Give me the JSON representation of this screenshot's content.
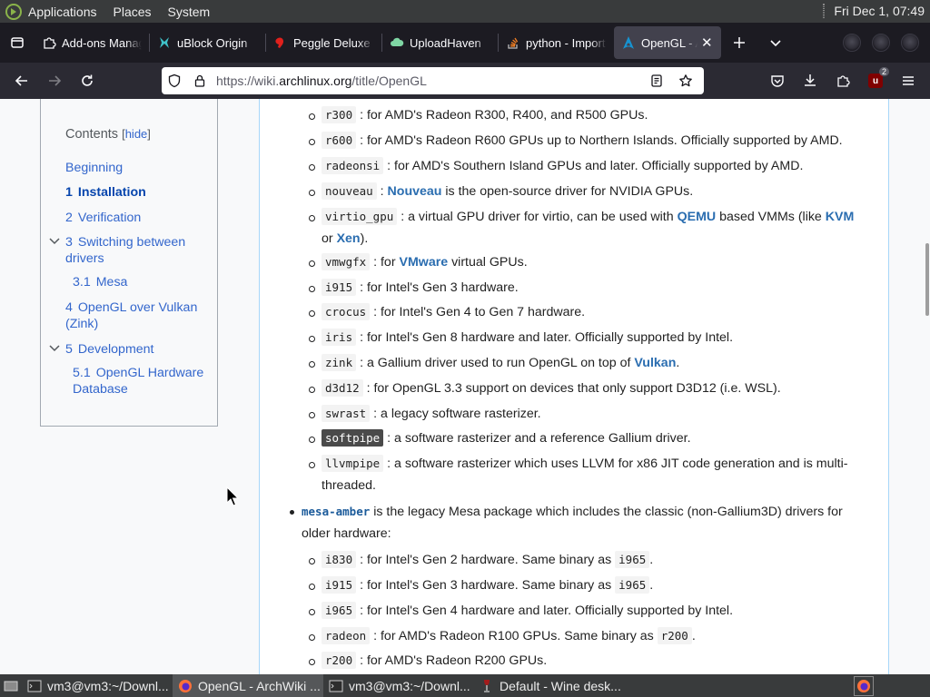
{
  "top_panel": {
    "menus": [
      "Applications",
      "Places",
      "System"
    ],
    "clock": "Fri Dec 1, 07:49"
  },
  "tabs": [
    {
      "title": "Add-ons Manager",
      "icon": "puzzle-icon"
    },
    {
      "title": "uBlock Origin",
      "icon": "ublock-icon"
    },
    {
      "title": "Peggle Deluxe",
      "icon": "peggle-icon"
    },
    {
      "title": "UploadHaven",
      "icon": "cloud-icon"
    },
    {
      "title": "python - Import",
      "icon": "stackoverflow-icon"
    },
    {
      "title": "OpenGL - ArchWiki",
      "icon": "arch-icon",
      "active": true
    }
  ],
  "urlbar": {
    "prefix": "https://wiki.",
    "domain": "archlinux.org",
    "path": "/title/OpenGL"
  },
  "ublock_count": "2",
  "toc": {
    "title": "Contents",
    "hide_label": "hide",
    "items": [
      {
        "num": "",
        "label": "Beginning"
      },
      {
        "num": "1",
        "label": "Installation"
      },
      {
        "num": "2",
        "label": "Verification"
      },
      {
        "num": "3",
        "label": "Switching between drivers"
      },
      {
        "num": "3.1",
        "label": "Mesa"
      },
      {
        "num": "4",
        "label": "OpenGL over Vulkan (Zink)"
      },
      {
        "num": "5",
        "label": "Development"
      },
      {
        "num": "5.1",
        "label": "OpenGL Hardware Database"
      }
    ]
  },
  "content": {
    "gallium_drivers": [
      {
        "code": "r300",
        "text": ": for AMD's Radeon R300, R400, and R500 GPUs."
      },
      {
        "code": "r600",
        "text": ": for AMD's Radeon R600 GPUs up to Northern Islands. Officially supported by AMD."
      },
      {
        "code": "radeonsi",
        "text": ": for AMD's Southern Island GPUs and later. Officially supported by AMD."
      },
      {
        "code": "nouveau",
        "text_pre": ": ",
        "link": "Nouveau",
        "text": " is the open-source driver for NVIDIA GPUs."
      },
      {
        "code": "virtio_gpu",
        "text_pre": ": a virtual GPU driver for virtio, can be used with ",
        "link": "QEMU",
        "text_mid": " based VMMs (like ",
        "link2": "KVM",
        "text2": "or ",
        "link3": "Xen",
        "text3": ")."
      },
      {
        "code": "vmwgfx",
        "text_pre": ": for ",
        "link": "VMware",
        "text": " virtual GPUs."
      },
      {
        "code": "i915",
        "text": ": for Intel's Gen 3 hardware."
      },
      {
        "code": "crocus",
        "text": ": for Intel's Gen 4 to Gen 7 hardware."
      },
      {
        "code": "iris",
        "text": ": for Intel's Gen 8 hardware and later. Officially supported by Intel."
      },
      {
        "code": "zink",
        "text_pre": ": a Gallium driver used to run OpenGL on top of ",
        "link": "Vulkan",
        "text": "."
      },
      {
        "code": "d3d12",
        "text": ": for OpenGL 3.3 support on devices that only support D3D12 (i.e. WSL)."
      },
      {
        "code": "swrast",
        "text": ": a legacy software rasterizer."
      },
      {
        "code": "softpipe",
        "text": ": a software rasterizer and a reference Gallium driver."
      },
      {
        "code": "llvmpipe",
        "text": ": a software rasterizer which uses LLVM for x86 JIT code generation and is multi-",
        "text2": "threaded."
      }
    ],
    "amber": {
      "pkg": "mesa-amber",
      "text": " is the legacy Mesa package which includes the classic (non-Gallium3D) drivers for",
      "text2": "older hardware:"
    },
    "amber_drivers": [
      {
        "code": "i830",
        "text": ": for Intel's Gen 2 hardware. Same binary as ",
        "code2": "i965",
        "tail": "."
      },
      {
        "code": "i915",
        "text": ": for Intel's Gen 3 hardware. Same binary as ",
        "code2": "i965",
        "tail": "."
      },
      {
        "code": "i965",
        "text": ": for Intel's Gen 4 hardware and later. Officially supported by Intel."
      },
      {
        "code": "radeon",
        "text": ": for AMD's Radeon R100 GPUs. Same binary as ",
        "code2": "r200",
        "tail": "."
      },
      {
        "code": "r200",
        "text": ": for AMD's Radeon R200 GPUs."
      }
    ]
  },
  "taskbar": {
    "items": [
      {
        "label": "vm3@vm3:~/Downl...",
        "icon": "terminal-icon"
      },
      {
        "label": "OpenGL - ArchWiki ...",
        "icon": "firefox-icon",
        "active": true
      },
      {
        "label": "vm3@vm3:~/Downl...",
        "icon": "terminal-icon"
      },
      {
        "label": "Default - Wine desk...",
        "icon": "wine-icon"
      }
    ]
  },
  "colors": {
    "panel": "#393b3c",
    "firefox_tabbar": "#1c1b22",
    "firefox_navbar": "#2b2a33",
    "link": "#2a6db0",
    "toc_link": "#3366cc"
  }
}
